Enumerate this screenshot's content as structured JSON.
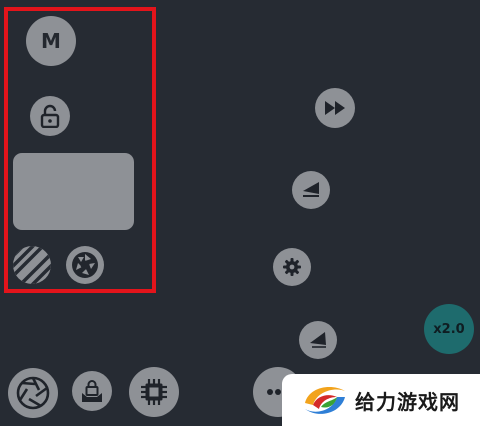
{
  "left_panel": {
    "mode_button": {
      "label": "M"
    },
    "lock_icon": "lock-open-icon",
    "pad": "touchpad",
    "stripes_icon": "stripes-icon",
    "aperture_icon": "aperture-icon"
  },
  "right_controls": {
    "fast_forward_icon": "fast-forward-icon",
    "rewind_icon": "rewind-icon",
    "settings_icon": "gear-icon",
    "back_icon": "back-arrow-icon",
    "speed": {
      "label": "x2.0"
    }
  },
  "bottom_bar": {
    "aperture_icon": "aperture-icon",
    "lock_tray_icon": "lock-tray-icon",
    "chip_icon": "chip-icon",
    "more_icon": "more-icon"
  },
  "watermark": {
    "text": "给力游戏网"
  },
  "colors": {
    "background": "#262b33",
    "button": "#8e9196",
    "highlight": "#e3141b",
    "speed_button": "#1e6b6d"
  }
}
